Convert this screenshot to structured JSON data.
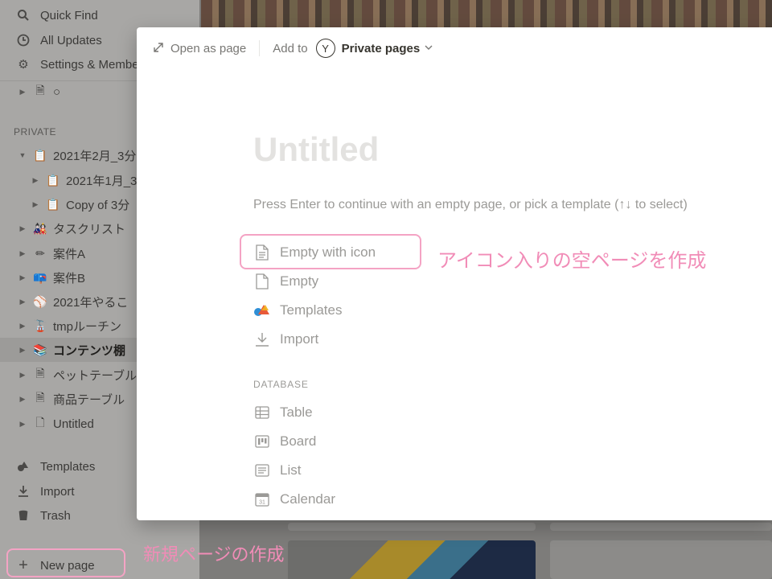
{
  "sidebar": {
    "top_items": [
      {
        "label": "Quick Find",
        "icon": "search-icon"
      },
      {
        "label": "All Updates",
        "icon": "clock-icon"
      },
      {
        "label": "Settings & Members",
        "icon": "gear-icon"
      }
    ],
    "pre_item": {
      "label": "○",
      "icon": "page-icon"
    },
    "section_label": "PRIVATE",
    "tree": [
      {
        "label": "2021年2月_3分",
        "icon": "clipboard-icon",
        "glyph": "📋",
        "indent": 1
      },
      {
        "label": "2021年1月_3",
        "icon": "clipboard-icon",
        "glyph": "📋",
        "indent": 2
      },
      {
        "label": "Copy of 3分",
        "icon": "clipboard-icon",
        "glyph": "📋",
        "indent": 2
      },
      {
        "label": "タスクリスト",
        "icon": "doll-icon",
        "glyph": "🎎",
        "indent": 1
      },
      {
        "label": "案件A",
        "icon": "pencil-icon",
        "glyph": "✏",
        "indent": 1
      },
      {
        "label": "案件B",
        "icon": "mailbox-icon",
        "glyph": "📪",
        "indent": 1
      },
      {
        "label": "2021年やるこ",
        "icon": "baseball-icon",
        "glyph": "⚾",
        "indent": 1
      },
      {
        "label": "tmpルーチン",
        "icon": "cable-car-icon",
        "glyph": "🚡",
        "indent": 1
      },
      {
        "label": "コンテンツ棚",
        "icon": "books-icon",
        "glyph": "📚",
        "indent": 1,
        "active": true
      },
      {
        "label": "ペットテーブル",
        "icon": "page-icon",
        "glyph": "🗎",
        "indent": 1
      },
      {
        "label": "商品テーブル",
        "icon": "page-icon",
        "glyph": "🗎",
        "indent": 1
      },
      {
        "label": "Untitled",
        "icon": "page-icon",
        "glyph": "🗋",
        "indent": 1
      }
    ],
    "bottom_items": [
      {
        "label": "Templates",
        "icon": "shapes-icon"
      },
      {
        "label": "Import",
        "icon": "download-icon"
      },
      {
        "label": "Trash",
        "icon": "trash-icon"
      }
    ],
    "new_page_label": "New page"
  },
  "modal": {
    "open_as_page": "Open as page",
    "add_to": "Add to",
    "avatar_letter": "Y",
    "target": "Private pages",
    "title_placeholder": "Untitled",
    "hint": "Press Enter to continue with an empty page, or pick a template (↑↓ to select)",
    "options": [
      {
        "label": "Empty with icon",
        "icon": "page-lines-icon"
      },
      {
        "label": "Empty",
        "icon": "blank-page-icon"
      },
      {
        "label": "Templates",
        "icon": "shapes-icon"
      },
      {
        "label": "Import",
        "icon": "download-icon"
      }
    ],
    "database_header": "DATABASE",
    "database_options": [
      {
        "label": "Table",
        "icon": "table-icon"
      },
      {
        "label": "Board",
        "icon": "board-icon"
      },
      {
        "label": "List",
        "icon": "list-icon"
      },
      {
        "label": "Calendar",
        "icon": "calendar-icon"
      }
    ]
  },
  "annotations": {
    "empty_with_icon_note": "アイコン入りの空ページを作成",
    "new_page_note": "新規ページの作成"
  },
  "colors": {
    "annotation": "#f18cb7",
    "modal_text_muted": "#9b9a97",
    "title_placeholder": "#e3e2e0"
  }
}
